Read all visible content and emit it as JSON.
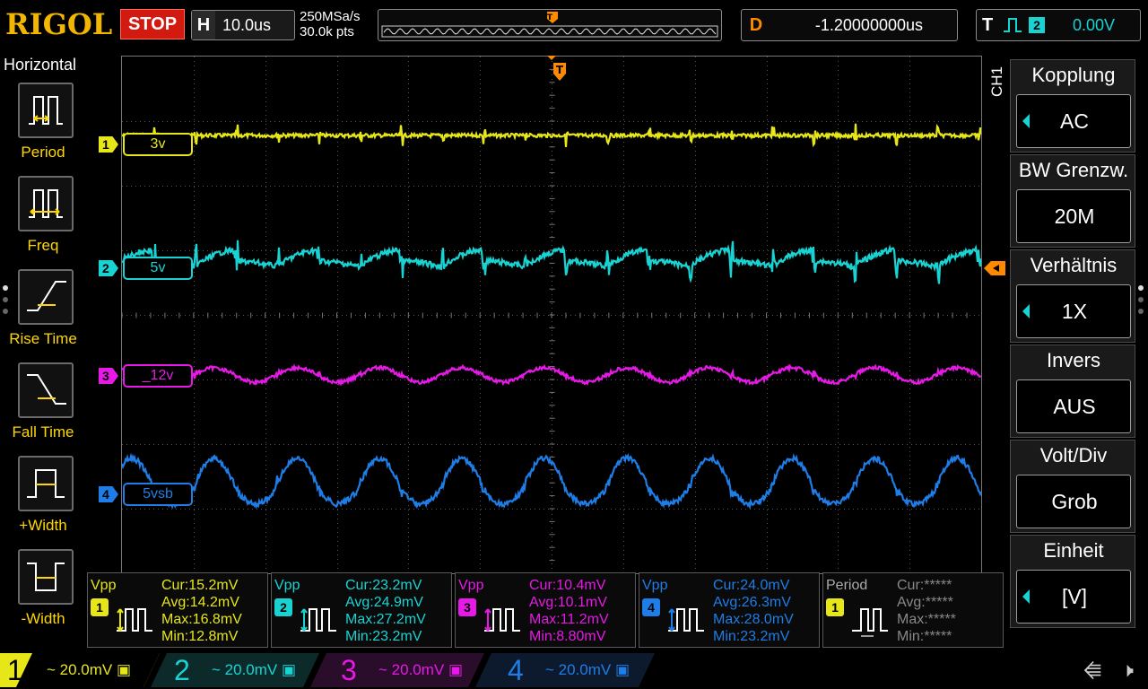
{
  "top": {
    "logo": "RIGOL",
    "run_state": "STOP",
    "timebase_label": "H",
    "timebase_value": "10.0us",
    "sample_rate": "250MSa/s",
    "mem_depth": "30.0k pts",
    "delay_label": "D",
    "delay_value": "-1.20000000us",
    "trigger_label": "T",
    "trigger_source": "2",
    "trigger_level": "0.00V"
  },
  "left_menu": {
    "title": "Horizontal",
    "items": [
      "Period",
      "Freq",
      "Rise Time",
      "Fall Time",
      "+Width",
      "-Width"
    ]
  },
  "channels": [
    {
      "num": "1",
      "label": "3v",
      "color": "#e6e619",
      "scale": "20.0mV"
    },
    {
      "num": "2",
      "label": "5v",
      "color": "#19d3d3",
      "scale": "20.0mV"
    },
    {
      "num": "3",
      "label": "_12v",
      "color": "#e619e6",
      "scale": "20.0mV"
    },
    {
      "num": "4",
      "label": "5vsb",
      "color": "#1e7de6",
      "scale": "20.0mV"
    }
  ],
  "right_menu": {
    "channel_tag": "CH1",
    "items": [
      {
        "title": "Kopplung",
        "value": "AC",
        "arrow": true
      },
      {
        "title": "BW Grenzw.",
        "value": "20M",
        "arrow": false
      },
      {
        "title": "Verhältnis",
        "value": "1X",
        "arrow": true
      },
      {
        "title": "Invers",
        "value": "AUS",
        "arrow": false
      },
      {
        "title": "Volt/Div",
        "value": "Grob",
        "arrow": false
      },
      {
        "title": "Einheit",
        "value": "[V]",
        "arrow": true
      }
    ]
  },
  "measurements": [
    {
      "title": "Vpp",
      "ch": "1",
      "color": "#e6e619",
      "cur": "Cur:15.2mV",
      "avg": "Avg:14.2mV",
      "max": "Max:16.8mV",
      "min": "Min:12.8mV"
    },
    {
      "title": "Vpp",
      "ch": "2",
      "color": "#19d3d3",
      "cur": "Cur:23.2mV",
      "avg": "Avg:24.9mV",
      "max": "Max:27.2mV",
      "min": "Min:23.2mV"
    },
    {
      "title": "Vpp",
      "ch": "3",
      "color": "#e619e6",
      "cur": "Cur:10.4mV",
      "avg": "Avg:10.1mV",
      "max": "Max:11.2mV",
      "min": "Min:8.80mV"
    },
    {
      "title": "Vpp",
      "ch": "4",
      "color": "#1e7de6",
      "cur": "Cur:24.0mV",
      "avg": "Avg:26.3mV",
      "max": "Max:28.0mV",
      "min": "Min:23.2mV"
    },
    {
      "title": "Period",
      "ch": "1",
      "color": "#888888",
      "cur": "Cur:*****",
      "avg": "Avg:*****",
      "max": "Max:*****",
      "min": "Min:*****"
    }
  ],
  "colors": {
    "accent": "#f2b600",
    "stop": "#d21a10",
    "trigger": "#ff8a00"
  }
}
